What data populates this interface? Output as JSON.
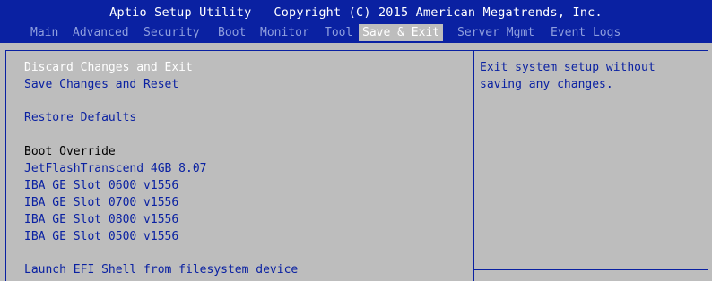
{
  "header": {
    "title": "Aptio Setup Utility – Copyright (C) 2015 American Megatrends, Inc.",
    "tabs": [
      {
        "label": "Main"
      },
      {
        "label": "Advanced"
      },
      {
        "label": "Security"
      },
      {
        "label": "Boot"
      },
      {
        "label": "Monitor"
      },
      {
        "label": "Tool"
      },
      {
        "label": "Save & Exit"
      },
      {
        "label": "Server Mgmt"
      },
      {
        "label": "Event Logs"
      }
    ],
    "active_tab": "Save & Exit"
  },
  "menu": {
    "items": [
      {
        "label": "Discard Changes and Exit"
      },
      {
        "label": "Save Changes and Reset"
      },
      {
        "label": "Restore Defaults"
      },
      {
        "label": "Boot Override"
      },
      {
        "label": "JetFlashTranscend 4GB 8.07"
      },
      {
        "label": "IBA GE Slot 0600 v1556"
      },
      {
        "label": "IBA GE Slot 0700 v1556"
      },
      {
        "label": "IBA GE Slot 0800 v1556"
      },
      {
        "label": "IBA GE Slot 0500 v1556"
      },
      {
        "label": "Launch EFI Shell from filesystem device"
      }
    ],
    "selected": "Discard Changes and Exit"
  },
  "help": {
    "lines": [
      "Exit system setup without",
      "saving any changes."
    ]
  },
  "colors": {
    "header_bg": "#0a21a2",
    "body_bg": "#bdbdbd",
    "item_text": "#0a21a2",
    "selected_text": "#ffffff",
    "inactive_tab": "#8f9fde"
  }
}
